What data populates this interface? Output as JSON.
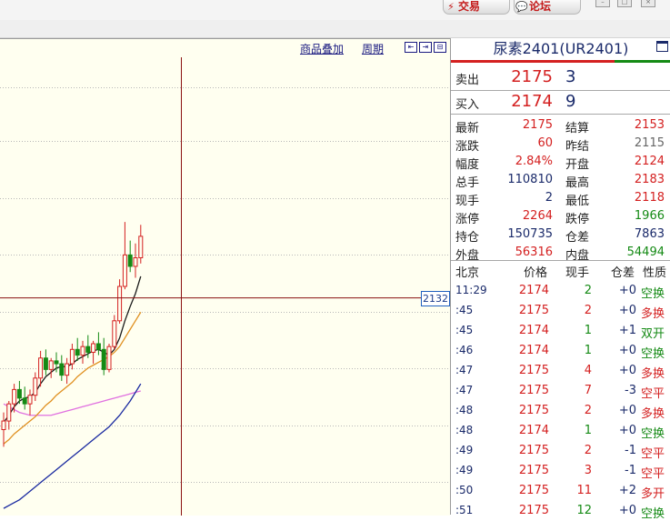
{
  "toolbar": {
    "trade_label": "交易",
    "forum_label": "论坛"
  },
  "chart": {
    "links": [
      "商品叠加",
      "周期"
    ],
    "price_tag": "2132",
    "nav_icons": [
      "left-arrow-icon",
      "right-arrow-icon",
      "split-icon"
    ]
  },
  "chart_data": {
    "type": "candlestick",
    "ohlc": [
      {
        "o": 2040,
        "h": 2052,
        "l": 2028,
        "c": 2046
      },
      {
        "o": 2046,
        "h": 2060,
        "l": 2040,
        "c": 2058
      },
      {
        "o": 2058,
        "h": 2072,
        "l": 2052,
        "c": 2068
      },
      {
        "o": 2068,
        "h": 2074,
        "l": 2058,
        "c": 2062
      },
      {
        "o": 2062,
        "h": 2070,
        "l": 2054,
        "c": 2058
      },
      {
        "o": 2058,
        "h": 2068,
        "l": 2050,
        "c": 2064
      },
      {
        "o": 2064,
        "h": 2080,
        "l": 2060,
        "c": 2076
      },
      {
        "o": 2076,
        "h": 2095,
        "l": 2070,
        "c": 2090
      },
      {
        "o": 2090,
        "h": 2096,
        "l": 2078,
        "c": 2082
      },
      {
        "o": 2082,
        "h": 2090,
        "l": 2076,
        "c": 2088
      },
      {
        "o": 2088,
        "h": 2094,
        "l": 2080,
        "c": 2086
      },
      {
        "o": 2086,
        "h": 2092,
        "l": 2074,
        "c": 2078
      },
      {
        "o": 2078,
        "h": 2090,
        "l": 2072,
        "c": 2086
      },
      {
        "o": 2086,
        "h": 2100,
        "l": 2082,
        "c": 2096
      },
      {
        "o": 2096,
        "h": 2104,
        "l": 2088,
        "c": 2092
      },
      {
        "o": 2092,
        "h": 2102,
        "l": 2086,
        "c": 2098
      },
      {
        "o": 2098,
        "h": 2106,
        "l": 2090,
        "c": 2094
      },
      {
        "o": 2094,
        "h": 2102,
        "l": 2086,
        "c": 2100
      },
      {
        "o": 2100,
        "h": 2108,
        "l": 2092,
        "c": 2096
      },
      {
        "o": 2096,
        "h": 2104,
        "l": 2078,
        "c": 2082
      },
      {
        "o": 2082,
        "h": 2100,
        "l": 2080,
        "c": 2098
      },
      {
        "o": 2098,
        "h": 2120,
        "l": 2096,
        "c": 2116
      },
      {
        "o": 2116,
        "h": 2145,
        "l": 2114,
        "c": 2140
      },
      {
        "o": 2140,
        "h": 2185,
        "l": 2138,
        "c": 2162
      },
      {
        "o": 2162,
        "h": 2172,
        "l": 2150,
        "c": 2154
      },
      {
        "o": 2154,
        "h": 2170,
        "l": 2146,
        "c": 2160
      },
      {
        "o": 2160,
        "h": 2183,
        "l": 2156,
        "c": 2175
      }
    ],
    "ma_short": [
      2045,
      2050,
      2056,
      2060,
      2062,
      2063,
      2066,
      2072,
      2077,
      2080,
      2083,
      2084,
      2084,
      2086,
      2089,
      2091,
      2093,
      2095,
      2096,
      2094,
      2092,
      2096,
      2104,
      2116,
      2126,
      2135,
      2147
    ],
    "ma_mid": [
      2030,
      2033,
      2037,
      2040,
      2043,
      2046,
      2049,
      2053,
      2057,
      2060,
      2064,
      2067,
      2070,
      2073,
      2077,
      2080,
      2083,
      2085,
      2087,
      2089,
      2091,
      2094,
      2098,
      2104,
      2110,
      2116,
      2122
    ],
    "ma_long": [
      1985,
      1987,
      1989,
      1991,
      1994,
      1997,
      2000,
      2003,
      2006,
      2009,
      2012,
      2015,
      2018,
      2021,
      2024,
      2027,
      2030,
      2033,
      2036,
      2039,
      2042,
      2046,
      2050,
      2055,
      2060,
      2066,
      2072
    ],
    "ma_slow": [
      2058,
      2056,
      2054,
      2052,
      2051,
      2050,
      2050,
      2050,
      2050,
      2050,
      2051,
      2052,
      2053,
      2054,
      2055,
      2056,
      2057,
      2058,
      2059,
      2060,
      2061,
      2062,
      2063,
      2064,
      2065,
      2066,
      2067
    ],
    "ylim": [
      1980,
      2300
    ],
    "reference_price": 2132,
    "grid": true,
    "colors": {
      "up": "#d42020",
      "down": "#148a14",
      "ma_short": "#1a1a1a",
      "ma_mid": "#e09020",
      "ma_long": "#1a2aa0",
      "ma_slow": "#e070e0",
      "crosshair": "#8a1010",
      "grid": "#b8b8b8",
      "background": "#fffff0"
    }
  },
  "panel": {
    "title": "尿素2401(UR2401)",
    "sell": {
      "label": "卖出",
      "price": "2175",
      "volume": "3"
    },
    "buy": {
      "label": "买入",
      "price": "2174",
      "volume": "9"
    },
    "quote_rows": [
      {
        "l1": "最新",
        "v1": "2175",
        "c1": "red",
        "l2": "结算",
        "v2": "2153",
        "c2": "red"
      },
      {
        "l1": "涨跌",
        "v1": "60",
        "c1": "red",
        "l2": "昨结",
        "v2": "2115",
        "c2": "gray"
      },
      {
        "l1": "幅度",
        "v1": "2.84%",
        "c1": "red",
        "l2": "开盘",
        "v2": "2124",
        "c2": "red"
      },
      {
        "l1": "总手",
        "v1": "110810",
        "c1": "dark",
        "l2": "最高",
        "v2": "2183",
        "c2": "red"
      },
      {
        "l1": "现手",
        "v1": "2",
        "c1": "dark",
        "l2": "最低",
        "v2": "2118",
        "c2": "red"
      },
      {
        "l1": "涨停",
        "v1": "2264",
        "c1": "red",
        "l2": "跌停",
        "v2": "1966",
        "c2": "green"
      },
      {
        "l1": "持仓",
        "v1": "150735",
        "c1": "dark",
        "l2": "仓差",
        "v2": "7863",
        "c2": "dark"
      },
      {
        "l1": "外盘",
        "v1": "56316",
        "c1": "red",
        "l2": "内盘",
        "v2": "54494",
        "c2": "green"
      }
    ],
    "ticks_header": {
      "time": "北京",
      "price": "价格",
      "volume": "现手",
      "diff": "仓差",
      "nature": "性质"
    },
    "ticks": [
      {
        "time": "11:29",
        "price": "2174",
        "volume": "2",
        "vc": "green",
        "diff": "+0",
        "nature": "空换",
        "nc": "green"
      },
      {
        "time": ":45",
        "price": "2175",
        "volume": "2",
        "vc": "red",
        "diff": "+0",
        "nature": "多换",
        "nc": "red"
      },
      {
        "time": ":45",
        "price": "2174",
        "volume": "1",
        "vc": "green",
        "diff": "+1",
        "nature": "双开",
        "nc": "green"
      },
      {
        "time": ":46",
        "price": "2174",
        "volume": "1",
        "vc": "green",
        "diff": "+0",
        "nature": "空换",
        "nc": "green"
      },
      {
        "time": ":47",
        "price": "2175",
        "volume": "4",
        "vc": "red",
        "diff": "+0",
        "nature": "多换",
        "nc": "red"
      },
      {
        "time": ":47",
        "price": "2175",
        "volume": "7",
        "vc": "red",
        "diff": "-3",
        "nature": "空平",
        "nc": "red"
      },
      {
        "time": ":48",
        "price": "2175",
        "volume": "2",
        "vc": "red",
        "diff": "+0",
        "nature": "多换",
        "nc": "red"
      },
      {
        "time": ":48",
        "price": "2174",
        "volume": "1",
        "vc": "green",
        "diff": "+0",
        "nature": "空换",
        "nc": "green"
      },
      {
        "time": ":49",
        "price": "2175",
        "volume": "2",
        "vc": "red",
        "diff": "-1",
        "nature": "空平",
        "nc": "red"
      },
      {
        "time": ":49",
        "price": "2175",
        "volume": "3",
        "vc": "red",
        "diff": "-1",
        "nature": "空平",
        "nc": "red"
      },
      {
        "time": ":50",
        "price": "2175",
        "volume": "11",
        "vc": "red",
        "diff": "+2",
        "nature": "多开",
        "nc": "red"
      },
      {
        "time": ":51",
        "price": "2175",
        "volume": "12",
        "vc": "green",
        "diff": "+0",
        "nature": "空换",
        "nc": "green"
      }
    ]
  }
}
